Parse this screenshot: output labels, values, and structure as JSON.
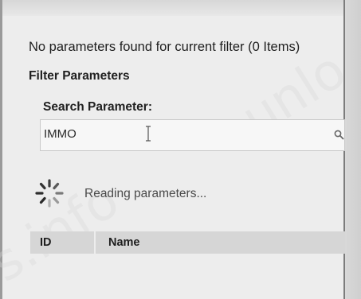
{
  "status": {
    "message": "No parameters found for current filter (0 Items)"
  },
  "filter": {
    "section_title": "Filter Parameters",
    "search_label": "Search Parameter:",
    "search_value": "IMMO",
    "search_icon": "magnifier-icon"
  },
  "loading": {
    "text": "Reading parameters...",
    "icon": "spinner-icon"
  },
  "table": {
    "columns": [
      "ID",
      "Name"
    ],
    "rows": []
  },
  "watermark": {
    "text_top": "unlo",
    "text_bottom": "s.info"
  },
  "colors": {
    "background": "#ededed",
    "header_fill": "#d6d6d6",
    "text": "#222222"
  }
}
